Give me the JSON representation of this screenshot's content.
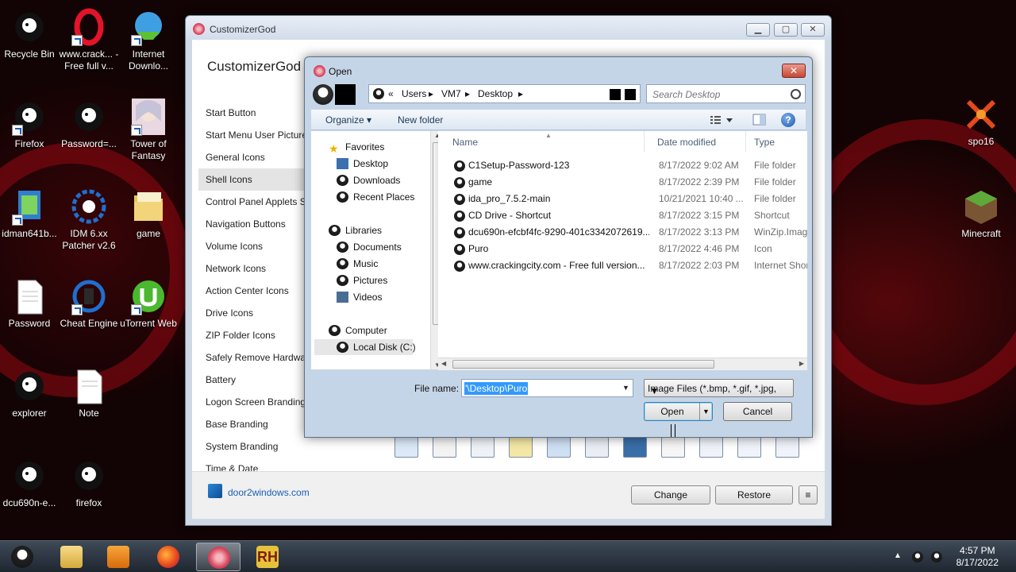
{
  "desktop_icons": [
    {
      "label": "Recycle Bin",
      "icon": "recycle-bin-icon"
    },
    {
      "label": "www.crack... - Free full v...",
      "icon": "opera-icon"
    },
    {
      "label": "Internet Downlo...",
      "icon": "idm-icon"
    },
    {
      "label": "Firefox",
      "icon": "app-icon"
    },
    {
      "label": "Password=...",
      "icon": "app-icon"
    },
    {
      "label": "Tower of Fantasy",
      "icon": "game-icon"
    },
    {
      "label": "idman641b...",
      "icon": "installer-icon"
    },
    {
      "label": "IDM 6.xx Patcher v2.6",
      "icon": "patcher-icon"
    },
    {
      "label": "game",
      "icon": "folder-icon"
    },
    {
      "label": "Password",
      "icon": "text-file-icon"
    },
    {
      "label": "Cheat Engine",
      "icon": "cheat-engine-icon"
    },
    {
      "label": "uTorrent Web",
      "icon": "utorrent-icon"
    },
    {
      "label": "explorer",
      "icon": "app-icon"
    },
    {
      "label": "Note",
      "icon": "text-file-icon"
    },
    {
      "label": "dcu690n-e...",
      "icon": "app-icon"
    },
    {
      "label": "firefox",
      "icon": "app-icon"
    },
    {
      "label": "spo16",
      "icon": "app-icon"
    },
    {
      "label": "Minecraft",
      "icon": "minecraft-icon"
    }
  ],
  "app": {
    "title": "CustomizerGod",
    "heading": "CustomizerGod",
    "nav_items": [
      "Start Button",
      "Start Menu User Picture",
      "General Icons",
      "Shell Icons",
      "Control Panel Applets S",
      "Navigation Buttons",
      "Volume Icons",
      "Network Icons",
      "Action Center Icons",
      "Drive Icons",
      "ZIP Folder Icons",
      "Safely Remove Hardwar",
      "Battery",
      "Logon Screen Branding",
      "Base Branding",
      "System Branding",
      "Time & Date"
    ],
    "selected_nav": "Shell Icons",
    "footer_link": "door2windows.com",
    "change_button": "Change",
    "restore_button": "Restore",
    "menu_button": "≡"
  },
  "dialog": {
    "title": "Open",
    "breadcrumb": [
      "«",
      "Users",
      "VM7",
      "Desktop"
    ],
    "search_placeholder": "Search Desktop",
    "organize": "Organize",
    "new_folder": "New folder",
    "help": "?",
    "nav_pane": {
      "favorites": "Favorites",
      "favorites_items": [
        "Desktop",
        "Downloads",
        "Recent Places"
      ],
      "libraries": "Libraries",
      "libraries_items": [
        "Documents",
        "Music",
        "Pictures",
        "Videos"
      ],
      "computer": "Computer",
      "computer_items": [
        "Local Disk (C:)"
      ]
    },
    "columns": [
      "Name",
      "Date modified",
      "Type"
    ],
    "files": [
      {
        "name": "C1Setup-Password-123",
        "date": "8/17/2022 9:02 AM",
        "type": "File folder"
      },
      {
        "name": "game",
        "date": "8/17/2022 2:39 PM",
        "type": "File folder"
      },
      {
        "name": "ida_pro_7.5.2-main",
        "date": "10/21/2021 10:40 ...",
        "type": "File folder"
      },
      {
        "name": "CD Drive - Shortcut",
        "date": "8/17/2022 3:15 PM",
        "type": "Shortcut"
      },
      {
        "name": "dcu690n-efcbf4fc-9290-401c3342072619....",
        "date": "8/17/2022 3:13 PM",
        "type": "WinZip.Imag"
      },
      {
        "name": "Puro",
        "date": "8/17/2022 4:46 PM",
        "type": "Icon"
      },
      {
        "name": "www.crackingcity.com - Free full version...",
        "date": "8/17/2022 2:03 PM",
        "type": "Internet Shor"
      }
    ],
    "file_name_label": "File name:",
    "file_name_value": "'\\Desktop\\Puro",
    "file_type": "Image Files (*.bmp, *.gif, *.jpg,",
    "open_button": "Open",
    "cancel_button": "Cancel"
  },
  "taskbar": {
    "time": "4:57 PM",
    "date": "8/17/2022",
    "rh_label": "RH"
  }
}
